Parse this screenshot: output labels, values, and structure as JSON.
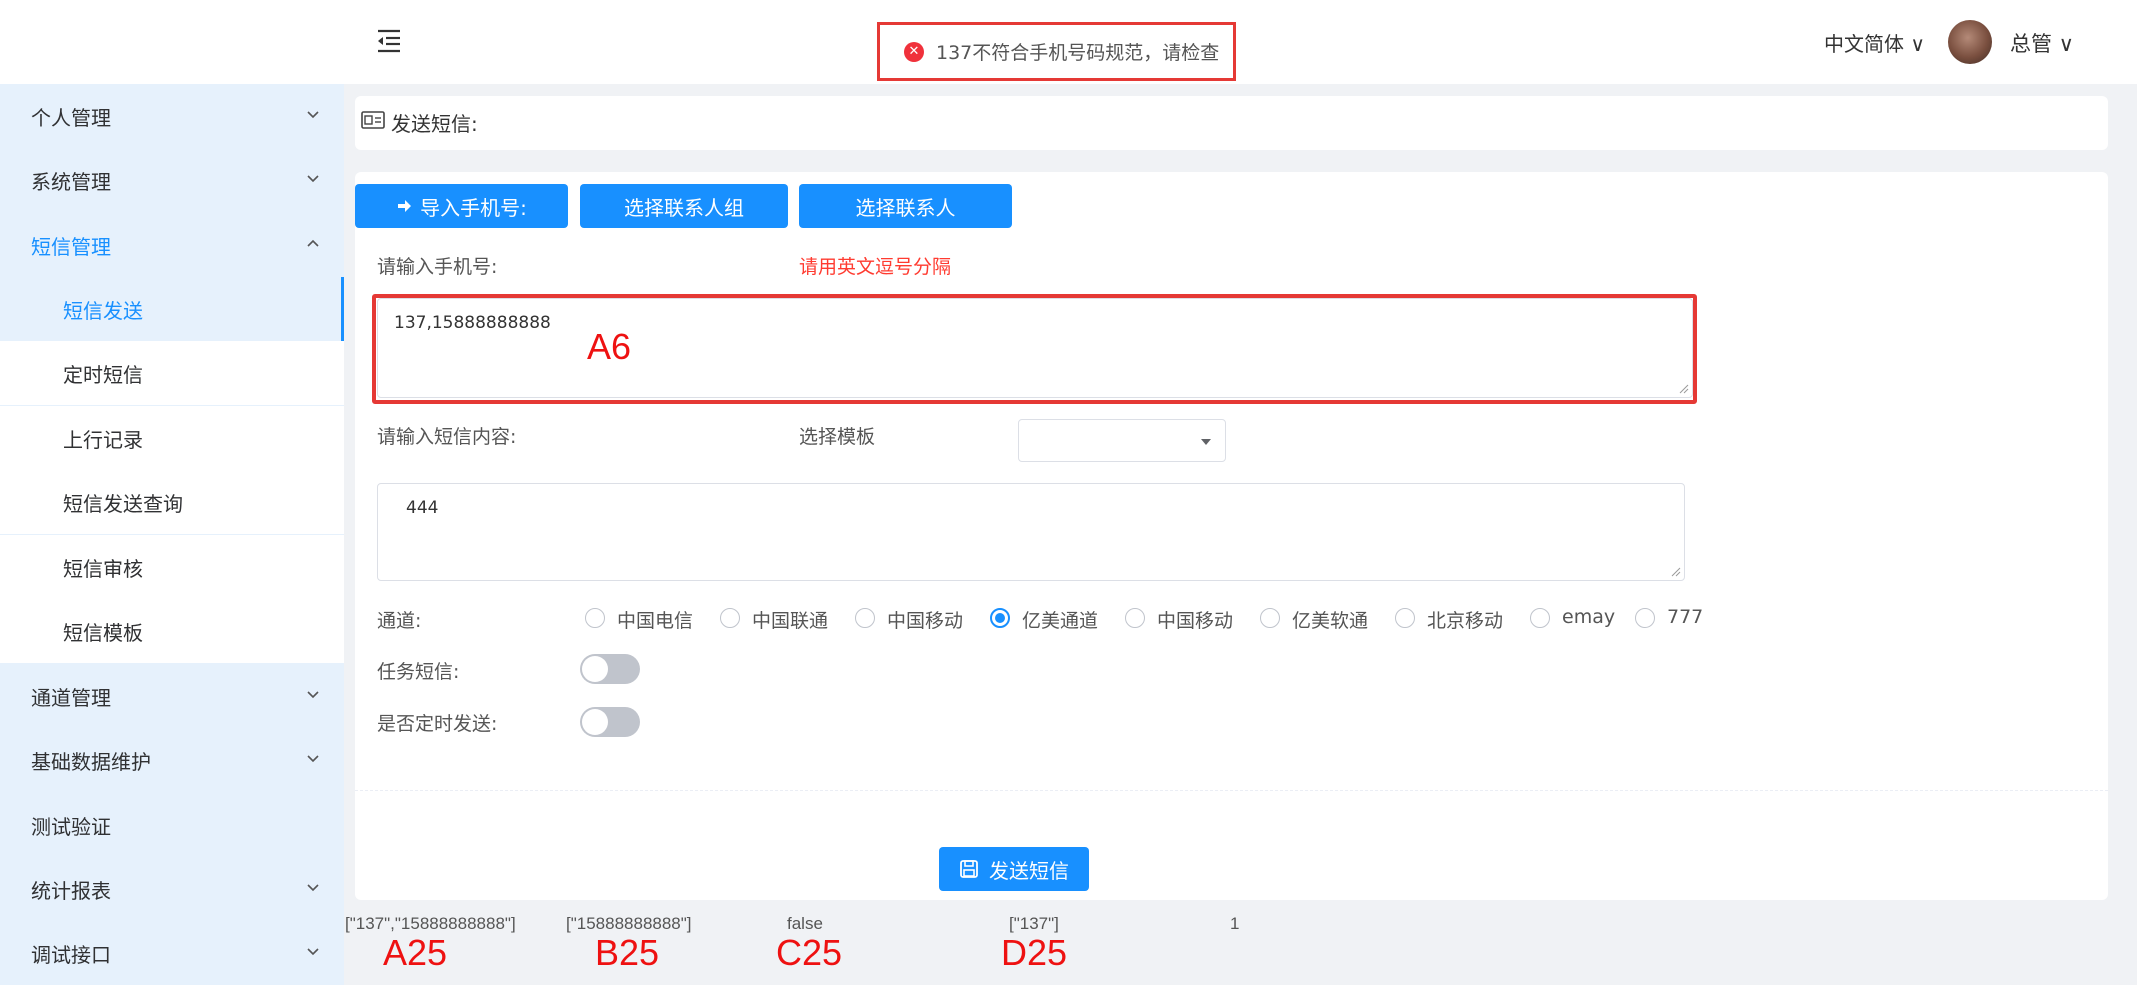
{
  "header": {
    "language": "中文简体 ∨",
    "username": "总管 ∨"
  },
  "toast": {
    "message": "137不符合手机号码规范，请检查"
  },
  "sidebar": {
    "items": [
      {
        "label": "个人管理"
      },
      {
        "label": "系统管理"
      },
      {
        "label": "短信管理"
      },
      {
        "label": "短信发送"
      },
      {
        "label": "定时短信"
      },
      {
        "label": "上行记录"
      },
      {
        "label": "短信发送查询"
      },
      {
        "label": "短信审核"
      },
      {
        "label": "短信模板"
      },
      {
        "label": "通道管理"
      },
      {
        "label": "基础数据维护"
      },
      {
        "label": "测试验证"
      },
      {
        "label": "统计报表"
      },
      {
        "label": "调试接口"
      }
    ]
  },
  "breadcrumb": {
    "title": "发送短信:"
  },
  "form": {
    "buttons": {
      "import": "导入手机号:",
      "select_group": "选择联系人组",
      "select_contact": "选择联系人"
    },
    "phone_label": "请输入手机号:",
    "phone_hint": "请用英文逗号分隔",
    "phone_value": "137,15888888888",
    "content_label": "请输入短信内容:",
    "template_label": "选择模板",
    "template_value": "",
    "content_value": "444",
    "channel_label": "通道:",
    "channels": [
      "中国电信",
      "中国联通",
      "中国移动",
      "亿美通道",
      "中国移动",
      "亿美软通",
      "北京移动",
      "emay",
      "777"
    ],
    "selected_channel": "亿美通道",
    "task_label": "任务短信:",
    "task_on": false,
    "schedule_label": "是否定时发送:",
    "schedule_on": false,
    "send_button": "发送短信"
  },
  "debug": {
    "a25": "[\"137\",\"15888888888\"]",
    "b25": "[\"15888888888\"]",
    "c25": "false",
    "d25": "[\"137\"]",
    "e25": "1"
  },
  "annotations": {
    "a6": "A6",
    "a25": "A25",
    "b25": "B25",
    "c25": "C25",
    "d25": "D25"
  },
  "colors": {
    "primary": "#1890ff",
    "sidebar_bg": "#e6f1fc",
    "error": "#f0313b",
    "annotation": "#ee1111"
  },
  "icons": [
    "menu-fold-icon",
    "chevron-down-icon",
    "chevron-up-icon",
    "id-card-icon",
    "sign-in-icon",
    "save-icon",
    "error-circle-icon",
    "caret-down-icon"
  ]
}
